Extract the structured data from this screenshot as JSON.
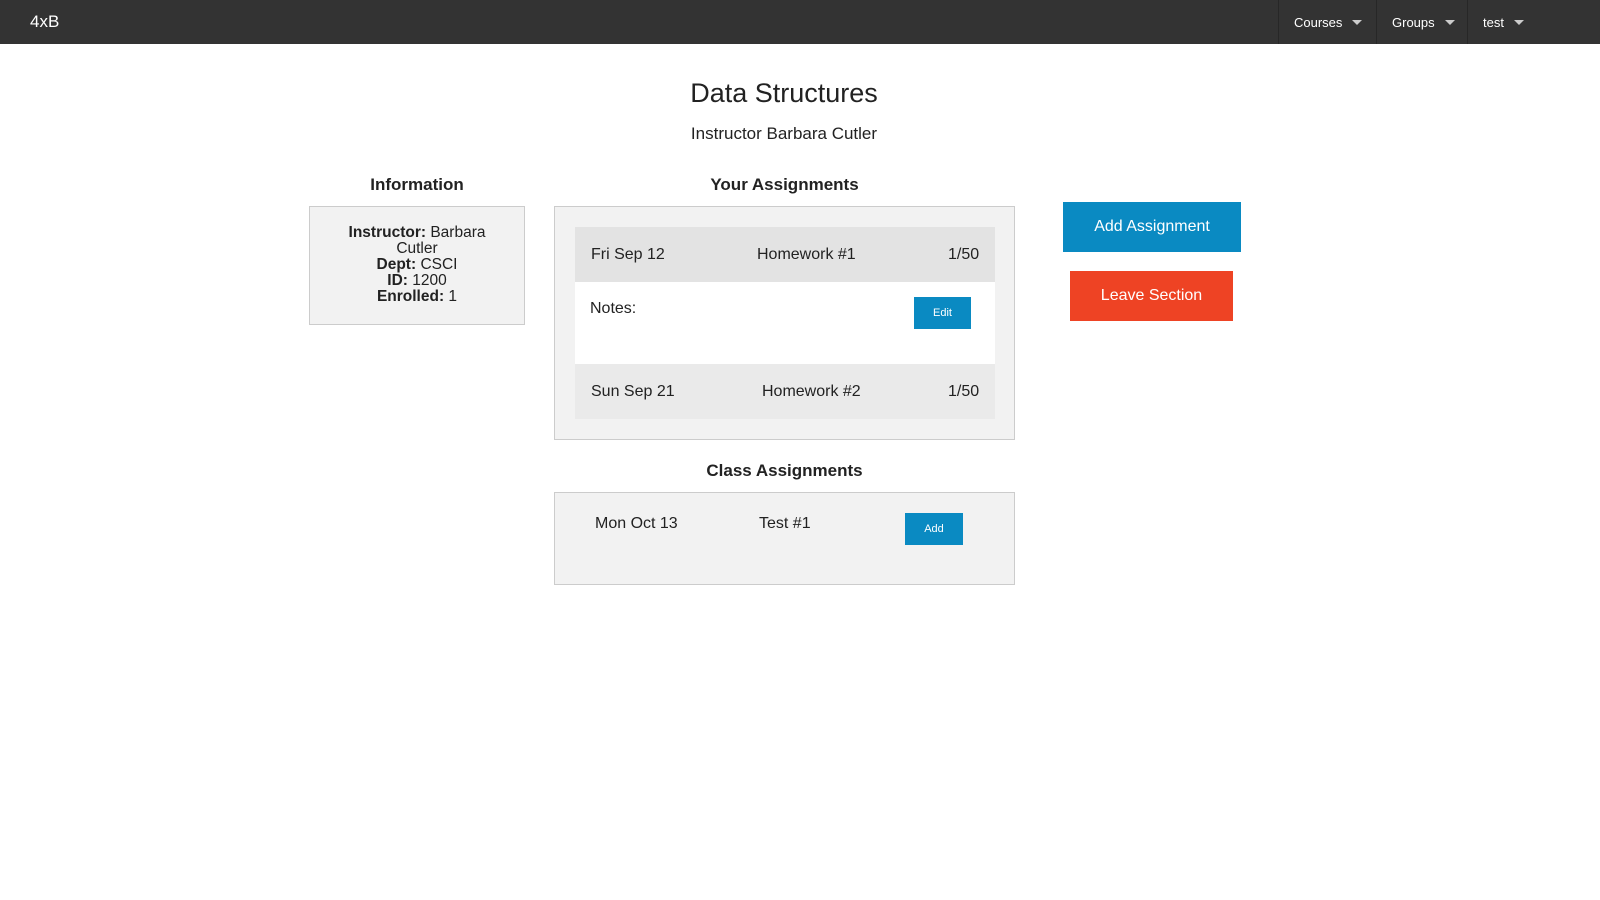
{
  "header": {
    "brand": "4xB",
    "nav": [
      {
        "label": "Courses"
      },
      {
        "label": "Groups"
      },
      {
        "label": "test"
      }
    ]
  },
  "course": {
    "title": "Data Structures",
    "subtitle": "Instructor Barbara Cutler"
  },
  "information": {
    "heading": "Information",
    "instructor_label": "Instructor:",
    "instructor_value": "Barbara Cutler",
    "dept_label": "Dept:",
    "dept_value": "CSCI",
    "id_label": "ID:",
    "id_value": "1200",
    "enrolled_label": "Enrolled:",
    "enrolled_value": "1"
  },
  "your_assignments": {
    "heading": "Your Assignments",
    "items": [
      {
        "date": "Fri Sep 12",
        "name": "Homework #1",
        "score": "1/50"
      },
      {
        "date": "Sun Sep 21",
        "name": "Homework #2",
        "score": "1/50"
      }
    ],
    "notes_label": "Notes:",
    "edit_label": "Edit"
  },
  "class_assignments": {
    "heading": "Class Assignments",
    "items": [
      {
        "date": "Mon Oct 13",
        "name": "Test #1",
        "add_label": "Add"
      }
    ]
  },
  "actions": {
    "add_assignment": "Add Assignment",
    "leave_section": "Leave Section"
  },
  "colors": {
    "topbar": "#333333",
    "primary": "#0a8ac2",
    "danger": "#ee4324",
    "panel": "#f2f2f2"
  }
}
